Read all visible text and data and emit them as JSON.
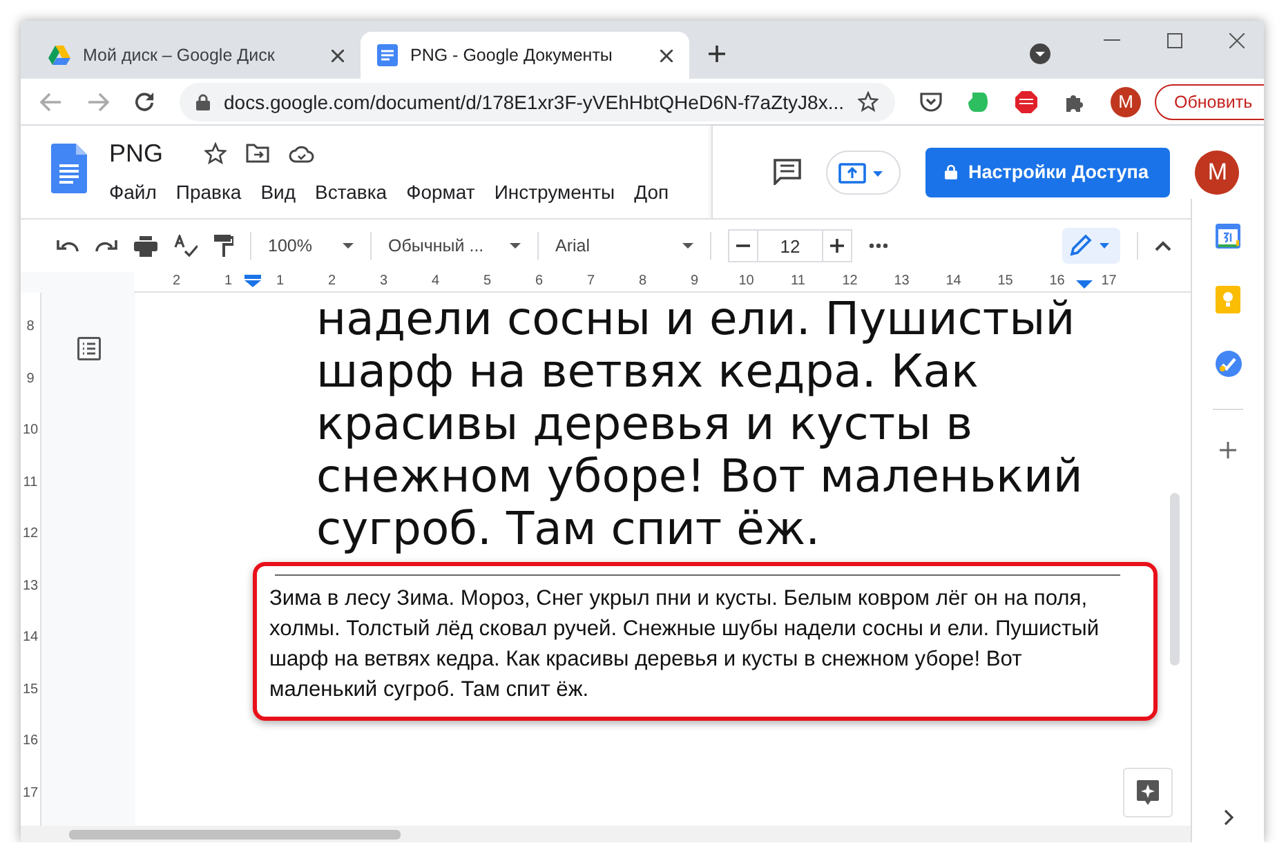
{
  "browser": {
    "tabs": [
      {
        "title": "Мой диск – Google Диск",
        "kind": "drive",
        "selected": false
      },
      {
        "title": "PNG - Google Документы",
        "kind": "docs",
        "selected": true
      }
    ],
    "url": "docs.google.com/document/d/178E1xr3F-yVEhHbtQHeD6N-f7aZtyJ8x...",
    "profile_initial": "M",
    "update_button": "Обновить"
  },
  "docs": {
    "title": "PNG",
    "menu": [
      "Файл",
      "Правка",
      "Вид",
      "Вставка",
      "Формат",
      "Инструменты",
      "Доп"
    ],
    "share_button": "Настройки Доступа",
    "avatar_initial": "M"
  },
  "toolbar": {
    "zoom": "100%",
    "style": "Обычный ...",
    "font": "Arial",
    "font_size": "12"
  },
  "ruler": {
    "horizontal": [
      "2",
      "1",
      "1",
      "2",
      "3",
      "4",
      "5",
      "6",
      "7",
      "8",
      "9",
      "10",
      "11",
      "12",
      "13",
      "14",
      "15",
      "16",
      "17"
    ],
    "vertical": [
      "8",
      "9",
      "10",
      "11",
      "12",
      "13",
      "14",
      "15",
      "16",
      "17"
    ]
  },
  "document": {
    "large_text": [
      "надели сосны и ели. Пушистый",
      "шарф на ветвях кедра. Как",
      "красивы деревья и кусты в",
      "снежном уборе! Вот маленький",
      "сугроб. Там спит ёж."
    ],
    "excerpt": "Зима в лесу Зима. Мороз, Снег укрыл пни и кусты. Белым ковром лёг он на поля, холмы. Толстый лёд сковал ручей. Снежные шубы надели сосны и ели. Пушистый шарф на ветвях кедра. Как красивы деревья и кусты в снежном уборе! Вот маленький сугроб. Там спит ёж."
  }
}
